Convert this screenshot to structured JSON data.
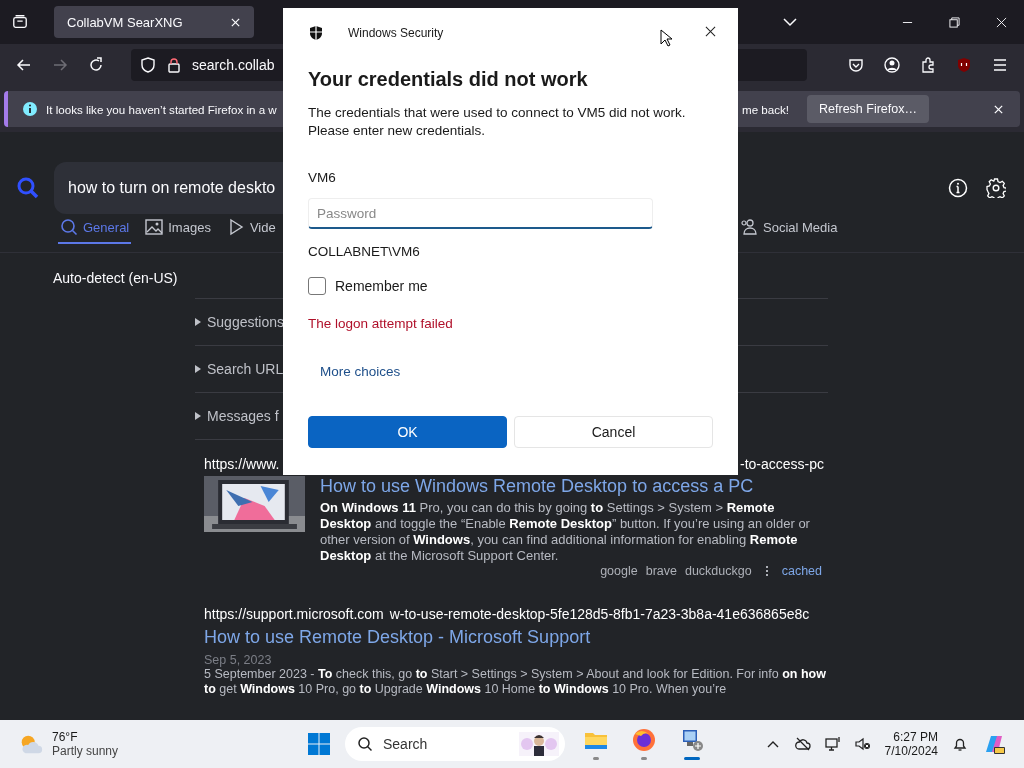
{
  "browser": {
    "tab": {
      "title": "CollabVM SearXNG"
    },
    "url": {
      "visible_text": "search.collab"
    },
    "notification": {
      "text_start": "It looks like you haven’t started Firefox in a w",
      "text_end": "me back!",
      "button": "Refresh Firefox…"
    }
  },
  "search": {
    "query": "how to turn on remote deskto",
    "categories": [
      {
        "label": "General",
        "selected": true
      },
      {
        "label": "Images",
        "selected": false
      },
      {
        "label": "Vide",
        "selected": false
      },
      {
        "label": "Social Media",
        "selected": false
      }
    ],
    "language": "Auto-detect (en-US)",
    "panels": [
      "Suggestions",
      "Search URL",
      "Messages f"
    ]
  },
  "results": [
    {
      "url_start": "https://www.",
      "url_end": "-to-access-pc",
      "thumbnail": {
        "kind": "picture"
      },
      "title": "How to use Windows Remote Desktop to access a PC",
      "snippet": "**On Windows 11** Pro, you can do this by going **to** Settings > System > **Remote Desktop** and toggle the “Enable **Remote Desktop**” button. If you’re using an older or other version of **Windows**, you can find additional information for enabling **Remote Desktop** at the Microsoft Support Center.",
      "engines": [
        "google",
        "brave",
        "duckduckgo"
      ],
      "cached": "cached"
    },
    {
      "url_start": "https://support.microsoft.com",
      "url_end": "w-to-use-remote-desktop-5fe128d5-8fb1-7a23-3b8a-41e636865e8c",
      "title": "How to use Remote Desktop - Microsoft Support",
      "date": "Sep 5, 2023",
      "snippet": "5 September 2023 - **To** check this, go **to** Start > Settings > System > About and look for Edition. For info **on how to** get **Windows** 10 Pro, go **to** Upgrade **Windows** 10 Home **to Windows** 10 Pro. When you’re"
    }
  ],
  "dialog": {
    "app": "Windows Security",
    "heading": "Your credentials did not work",
    "message": "The credentials that were used to connect to VM5 did not work. Please enter new credentials.",
    "target": "VM6",
    "password": {
      "placeholder": "Password"
    },
    "user": "COLLABNET\\VM6",
    "remember": {
      "label": "Remember me",
      "checked": false
    },
    "error": "The logon attempt failed",
    "link": "More choices",
    "buttons": [
      {
        "label": "OK",
        "primary": true
      },
      {
        "label": "Cancel",
        "primary": false
      }
    ]
  },
  "taskbar": {
    "weather": {
      "temperature": "76°F",
      "condition": "Partly sunny"
    },
    "search": {
      "placeholder": "Search"
    },
    "apps": [
      {
        "active": false
      },
      {
        "active": false
      },
      {
        "active": true
      }
    ],
    "clock": {
      "time": "6:27 PM",
      "date": "7/10/2024"
    }
  }
}
